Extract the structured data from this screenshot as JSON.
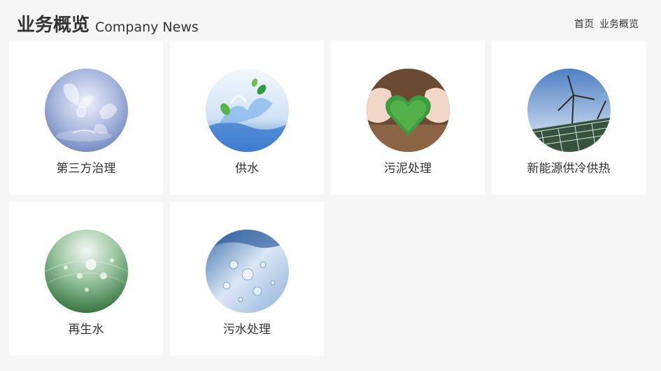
{
  "header": {
    "title_cn": "业务概览",
    "title_en": "Company News",
    "breadcrumb": [
      "首页",
      "业务概览"
    ]
  },
  "services": [
    {
      "label": "第三方治理",
      "image": "butterfly-water-image"
    },
    {
      "label": "供水",
      "image": "water-splash-leaves-image"
    },
    {
      "label": "污泥处理",
      "image": "hands-green-heart-image"
    },
    {
      "label": "新能源供冷供热",
      "image": "wind-solar-image"
    },
    {
      "label": "再生水",
      "image": "dew-leaf-image"
    },
    {
      "label": "污水处理",
      "image": "water-droplets-image"
    }
  ]
}
